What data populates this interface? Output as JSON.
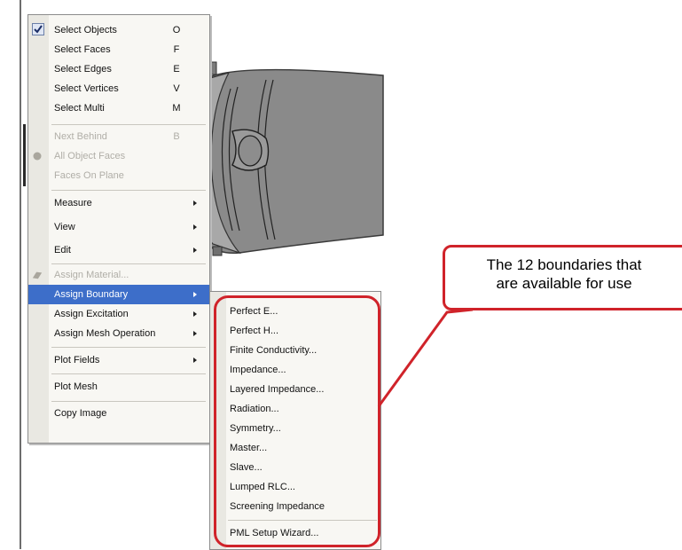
{
  "context_menu": {
    "items": [
      {
        "label": "Select Objects",
        "shortcut": "O",
        "checked": true
      },
      {
        "label": "Select Faces",
        "shortcut": "F"
      },
      {
        "label": "Select Edges",
        "shortcut": "E"
      },
      {
        "label": "Select Vertices",
        "shortcut": "V"
      },
      {
        "label": "Select Multi",
        "shortcut": "M"
      },
      {
        "label": "Next Behind",
        "shortcut": "B",
        "disabled": true
      },
      {
        "label": "All Object Faces",
        "disabled": true
      },
      {
        "label": "Faces On Plane",
        "disabled": true
      },
      {
        "label": "Measure",
        "submenu": true
      },
      {
        "label": "View",
        "submenu": true
      },
      {
        "label": "Edit",
        "submenu": true
      },
      {
        "label": "Assign Material...",
        "disabled": true
      },
      {
        "label": "Assign Boundary",
        "submenu": true,
        "highlighted": true
      },
      {
        "label": "Assign Excitation",
        "submenu": true
      },
      {
        "label": "Assign Mesh Operation",
        "submenu": true
      },
      {
        "label": "Plot Fields",
        "submenu": true
      },
      {
        "label": "Plot Mesh"
      },
      {
        "label": "Copy Image"
      }
    ]
  },
  "boundary_submenu": {
    "items": [
      {
        "label": "Perfect E..."
      },
      {
        "label": "Perfect H..."
      },
      {
        "label": "Finite Conductivity..."
      },
      {
        "label": "Impedance..."
      },
      {
        "label": "Layered Impedance..."
      },
      {
        "label": "Radiation..."
      },
      {
        "label": "Symmetry..."
      },
      {
        "label": "Master..."
      },
      {
        "label": "Slave..."
      },
      {
        "label": "Lumped RLC..."
      },
      {
        "label": "Screening Impedance"
      },
      {
        "label": "PML Setup Wizard..."
      }
    ]
  },
  "callout": {
    "line1": "The 12 boundaries that",
    "line2": "are available for use"
  },
  "colors": {
    "highlight": "#3d6ec9",
    "annotation_red": "#d0232a",
    "menu_background": "#f8f7f3"
  }
}
